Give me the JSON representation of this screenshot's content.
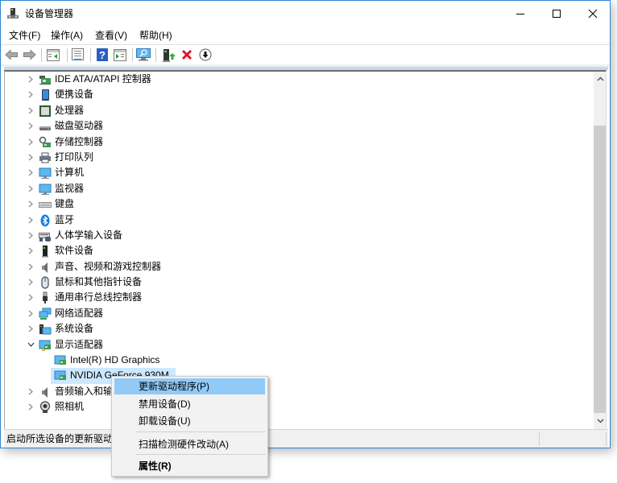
{
  "window": {
    "title": "设备管理器",
    "app_icon": "device-manager-icon",
    "controls": {
      "minimize": "minimize-icon",
      "maximize": "maximize-icon",
      "close": "close-icon"
    }
  },
  "menubar": {
    "items": [
      {
        "label": "文件(F)"
      },
      {
        "label": "操作(A)"
      },
      {
        "label": "查看(V)"
      },
      {
        "label": "帮助(H)"
      }
    ]
  },
  "toolbar": {
    "buttons": [
      {
        "name": "back",
        "icon": "back-arrow-icon"
      },
      {
        "name": "forward",
        "icon": "forward-arrow-icon"
      },
      {
        "name": "show-hide-console-tree",
        "icon": "console-tree-icon"
      },
      {
        "name": "properties",
        "icon": "properties-icon"
      },
      {
        "name": "help",
        "icon": "help-icon"
      },
      {
        "name": "show-action-pane",
        "icon": "action-pane-icon"
      },
      {
        "name": "scan-hardware",
        "icon": "scan-monitor-icon"
      },
      {
        "name": "update-driver",
        "icon": "update-driver-icon"
      },
      {
        "name": "uninstall-device",
        "icon": "red-x-icon"
      },
      {
        "name": "disable-device",
        "icon": "down-arrow-circle-icon"
      }
    ]
  },
  "tree": {
    "items": [
      {
        "label": "IDE ATA/ATAPI 控制器",
        "icon": "ide-controller-icon",
        "expanded": false
      },
      {
        "label": "便携设备",
        "icon": "portable-device-icon",
        "expanded": false
      },
      {
        "label": "处理器",
        "icon": "processor-icon",
        "expanded": false
      },
      {
        "label": "磁盘驱动器",
        "icon": "disk-drive-icon",
        "expanded": false
      },
      {
        "label": "存储控制器",
        "icon": "storage-controller-icon",
        "expanded": false
      },
      {
        "label": "打印队列",
        "icon": "printer-icon",
        "expanded": false
      },
      {
        "label": "计算机",
        "icon": "computer-icon",
        "expanded": false
      },
      {
        "label": "监视器",
        "icon": "monitor-icon",
        "expanded": false
      },
      {
        "label": "键盘",
        "icon": "keyboard-icon",
        "expanded": false
      },
      {
        "label": "蓝牙",
        "icon": "bluetooth-icon",
        "expanded": false
      },
      {
        "label": "人体学输入设备",
        "icon": "hid-icon",
        "expanded": false
      },
      {
        "label": "软件设备",
        "icon": "software-device-icon",
        "expanded": false
      },
      {
        "label": "声音、视频和游戏控制器",
        "icon": "speaker-icon",
        "expanded": false
      },
      {
        "label": "鼠标和其他指针设备",
        "icon": "mouse-icon",
        "expanded": false
      },
      {
        "label": "通用串行总线控制器",
        "icon": "usb-icon",
        "expanded": false
      },
      {
        "label": "网络适配器",
        "icon": "network-adapter-icon",
        "expanded": false
      },
      {
        "label": "系统设备",
        "icon": "system-device-icon",
        "expanded": false
      },
      {
        "label": "显示适配器",
        "icon": "display-adapter-icon",
        "expanded": true,
        "children": [
          {
            "label": "Intel(R) HD Graphics",
            "icon": "display-adapter-icon",
            "selected": false
          },
          {
            "label": "NVIDIA GeForce 930M",
            "icon": "display-adapter-icon",
            "selected": true
          }
        ]
      },
      {
        "label": "音频输入和输出",
        "icon": "speaker-icon",
        "expanded": false
      },
      {
        "label": "照相机",
        "icon": "camera-icon",
        "expanded": false
      }
    ]
  },
  "status_bar": {
    "text": "启动所选设备的更新驱动程序。"
  },
  "context_menu": {
    "items": [
      {
        "label": "更新驱动程序(P)",
        "highlighted": true,
        "bold": false
      },
      {
        "label": "禁用设备(D)",
        "highlighted": false,
        "bold": false
      },
      {
        "label": "卸载设备(U)",
        "highlighted": false,
        "bold": false
      },
      {
        "separator": true
      },
      {
        "label": "扫描检测硬件改动(A)",
        "highlighted": false,
        "bold": false
      },
      {
        "separator": true
      },
      {
        "label": "属性(R)",
        "highlighted": false,
        "bold": true
      }
    ]
  },
  "colors": {
    "window_border": "#2f86d6",
    "selection": "#cce8ff",
    "menu_highlight": "#91c9f7",
    "uninstall_red": "#e81123",
    "help_blue": "#2a5fbf"
  }
}
